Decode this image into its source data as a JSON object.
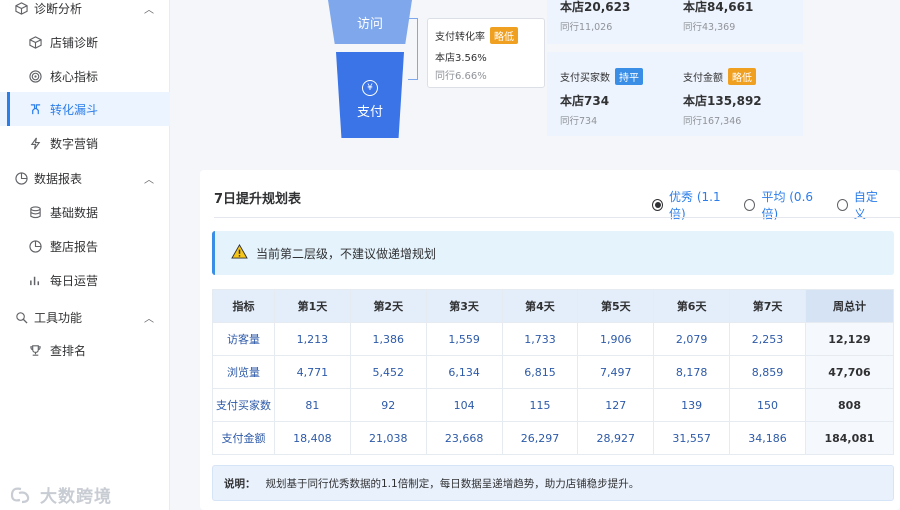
{
  "sidebar": {
    "groups": [
      {
        "label": "诊断分析",
        "icon": "cube-icon"
      },
      {
        "label": "数据报表",
        "icon": "pie-chart-icon"
      },
      {
        "label": "工具功能",
        "icon": "search-icon"
      }
    ],
    "items": [
      {
        "label": "店铺诊断",
        "icon": "box-icon"
      },
      {
        "label": "核心指标",
        "icon": "target-icon"
      },
      {
        "label": "转化漏斗",
        "icon": "funnel-icon"
      },
      {
        "label": "数字营销",
        "icon": "lightning-icon"
      },
      {
        "label": "基础数据",
        "icon": "database-icon"
      },
      {
        "label": "整店报告",
        "icon": "pie-chart-icon"
      },
      {
        "label": "每日运营",
        "icon": "bar-chart-icon"
      },
      {
        "label": "查排名",
        "icon": "trophy-icon"
      }
    ],
    "active_item": "转化漏斗"
  },
  "funnel": {
    "visit_label": "访问",
    "pay_label": "支付",
    "conversion": {
      "title": "支付转化率",
      "tag": "略低",
      "store": "本店3.56%",
      "peer": "同行6.66%"
    },
    "stats": {
      "visitors": {
        "store": "本店20,623",
        "peer": "同行11,026"
      },
      "views": {
        "store": "本店84,661",
        "peer": "同行43,369"
      },
      "buyers": {
        "title": "支付买家数",
        "tag": "持平",
        "store": "本店734",
        "peer": "同行734"
      },
      "amount": {
        "title": "支付金额",
        "tag": "略低",
        "store": "本店135,892",
        "peer": "同行167,346"
      }
    }
  },
  "plan": {
    "title": "7日提升规划表",
    "options": [
      "优秀 (1.1倍)",
      "平均 (0.6倍)",
      "自定义"
    ],
    "selected": "优秀 (1.1倍)",
    "alert": "当前第二层级，不建议做递增规划",
    "headers": [
      "指标",
      "第1天",
      "第2天",
      "第3天",
      "第4天",
      "第5天",
      "第6天",
      "第7天",
      "周总计"
    ],
    "rows": [
      [
        "访客量",
        "1,213",
        "1,386",
        "1,559",
        "1,733",
        "1,906",
        "2,079",
        "2,253",
        "12,129"
      ],
      [
        "浏览量",
        "4,771",
        "5,452",
        "6,134",
        "6,815",
        "7,497",
        "8,178",
        "8,859",
        "47,706"
      ],
      [
        "支付买家数",
        "81",
        "92",
        "104",
        "115",
        "127",
        "139",
        "150",
        "808"
      ],
      [
        "支付金额",
        "18,408",
        "21,038",
        "23,668",
        "26,297",
        "28,927",
        "31,557",
        "34,186",
        "184,081"
      ]
    ],
    "note_label": "说明：",
    "note": "规划基于同行优秀数据的1.1倍制定，每日数据呈递增趋势，助力店铺稳步提升。"
  },
  "watermark": "大数跨境",
  "colors": {
    "accent": "#2b7de9",
    "tag_orange": "#f0a020",
    "tag_blue": "#3a8ee6"
  }
}
